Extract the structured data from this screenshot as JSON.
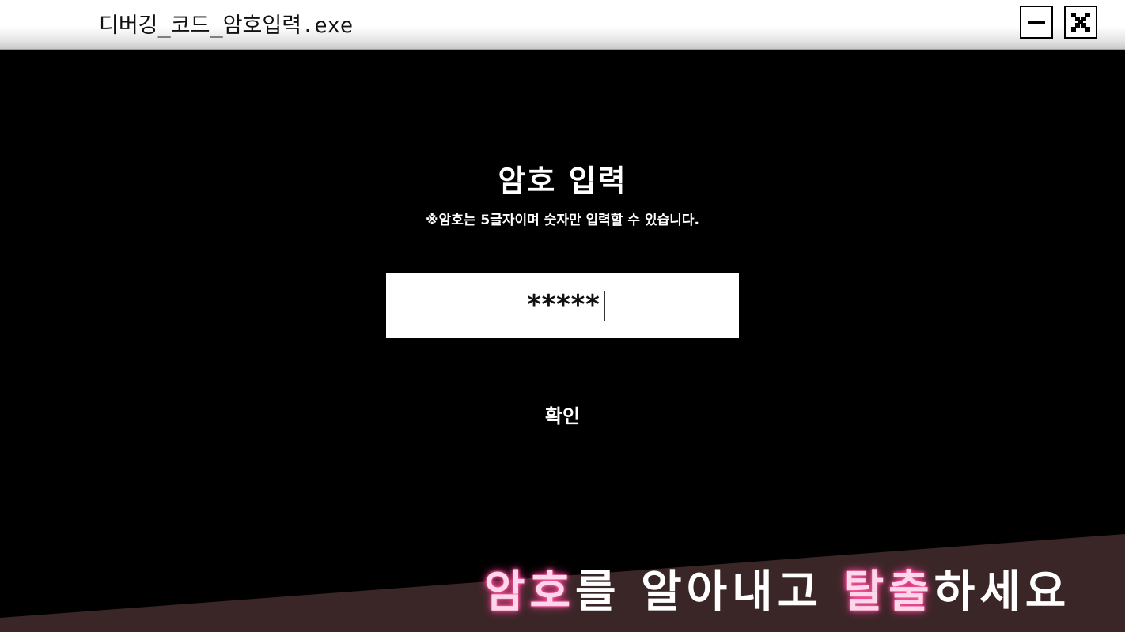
{
  "window": {
    "title": "디버깅_코드_암호입력.exe"
  },
  "dialog": {
    "heading": "암호 입력",
    "hint": "※암호는 5글자이며 숫자만 입력할 수 있습니다.",
    "password_value": "*****",
    "confirm_label": "확인"
  },
  "banner": {
    "part1": "암호",
    "part2": "를 알아내고 ",
    "part3": "탈출",
    "part4": "하세요"
  },
  "colors": {
    "background": "#000000",
    "banner_fill": "#3a2627",
    "accent_glow": "#ff5aa6"
  }
}
